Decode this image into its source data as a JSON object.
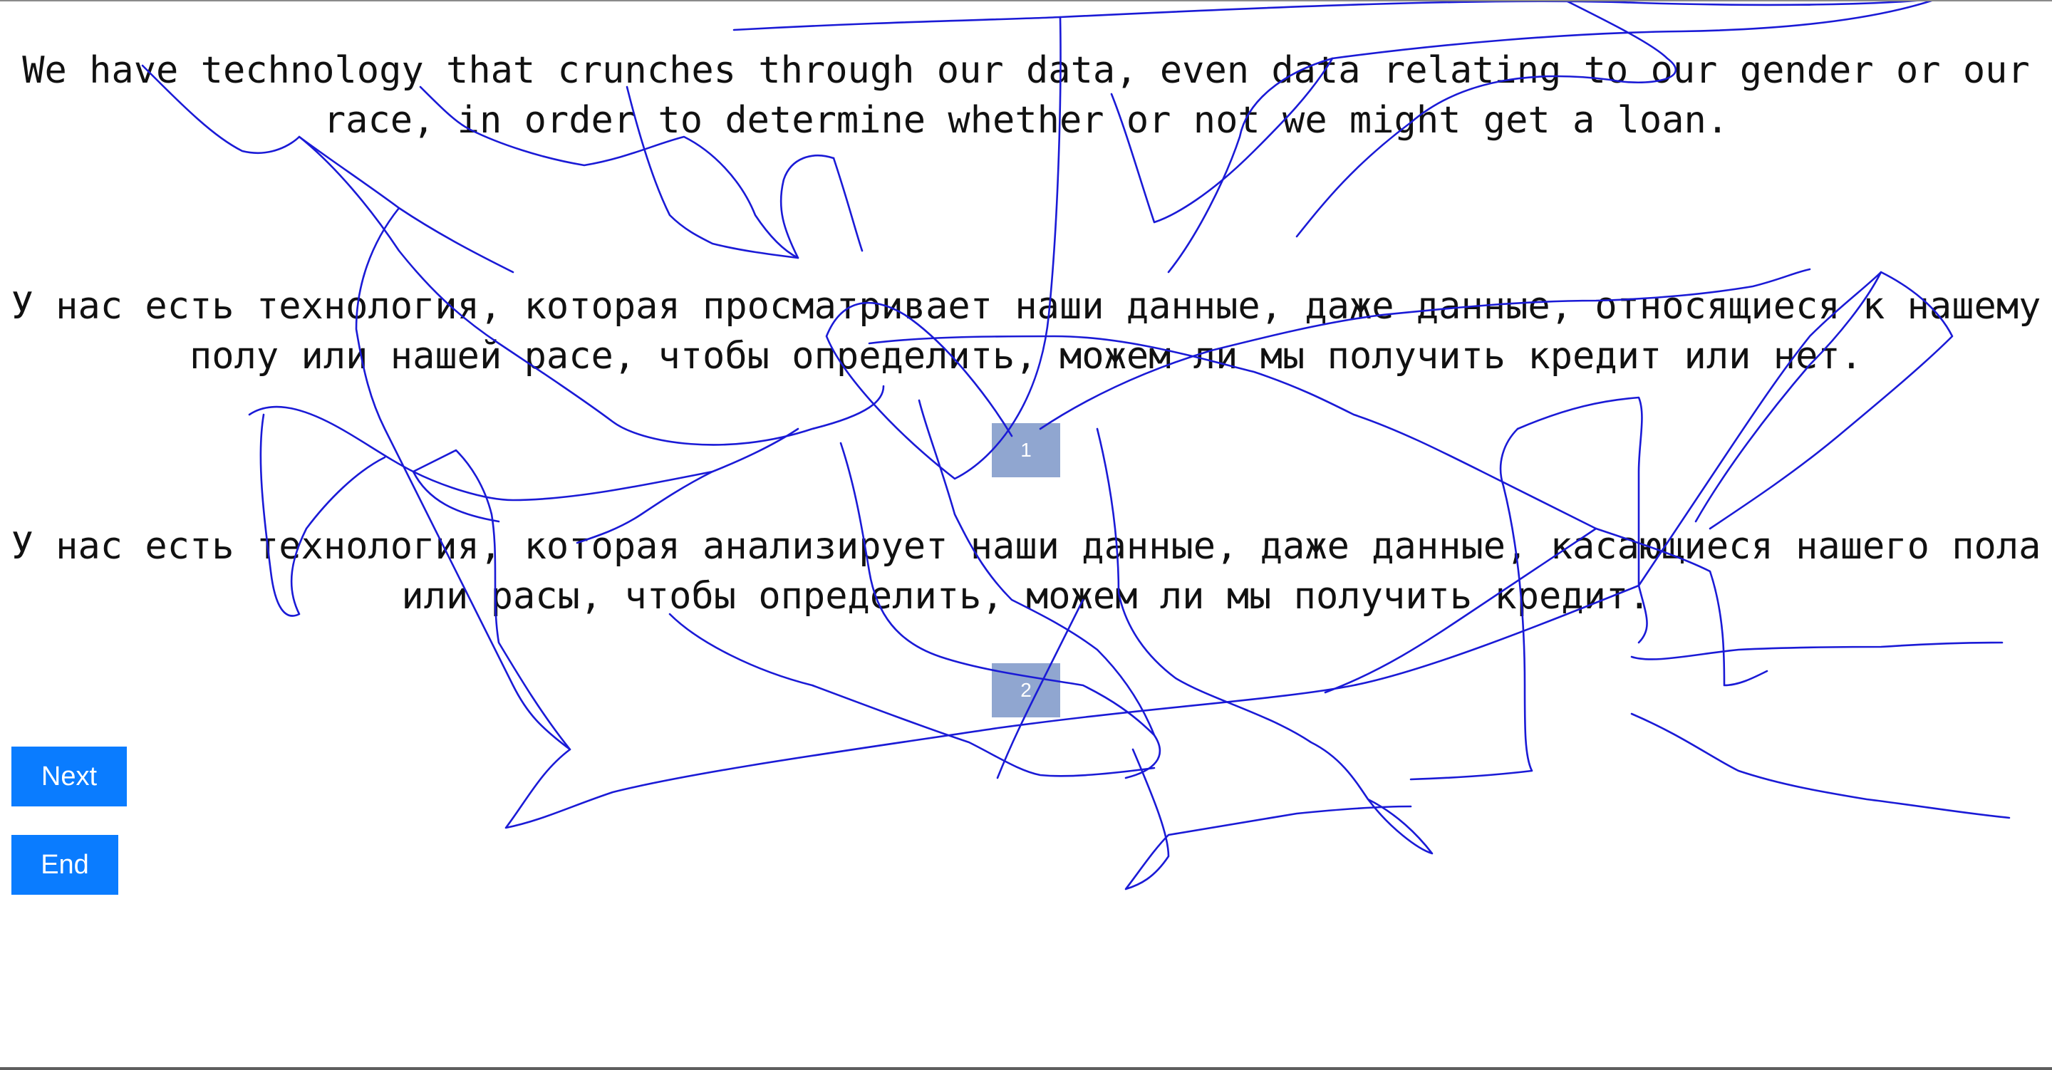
{
  "colors": {
    "background": "#ffffff",
    "text": "#111111",
    "badge": "#90a6d0",
    "button": "#0a7cff",
    "scribble": "#1a1ad6"
  },
  "source_sentence": "We have technology that crunches through our data, even data relating to our gender or our race, in order to determine whether or not we might get a loan.",
  "options": [
    {
      "number": "1",
      "text": "У нас есть технология, которая просматривает наши данные, даже данные, относящиеся к нашему полу или нашей расе, чтобы определить, можем ли мы получить кредит или нет."
    },
    {
      "number": "2",
      "text": "У нас есть технология, которая анализирует наши данные, даже данные, касающиеся нашего пола или расы, чтобы определить, можем ли мы получить кредит."
    }
  ],
  "buttons": {
    "next_label": "Next",
    "end_label": "End"
  },
  "drawing": {
    "type": "freehand-scribble-overlay",
    "color_name": "blue"
  }
}
